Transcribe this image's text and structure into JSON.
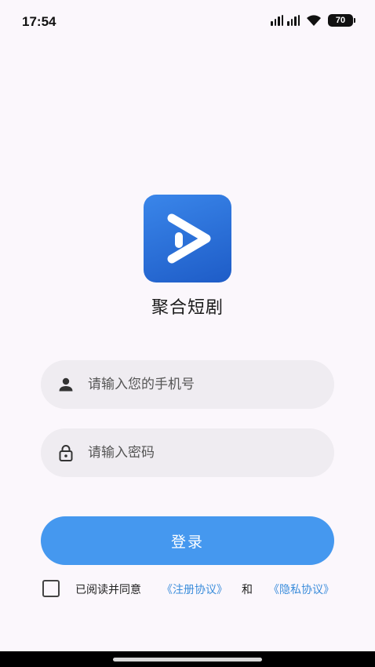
{
  "status_bar": {
    "time": "17:54",
    "battery": "70",
    "icons": [
      "signal-icon",
      "wifi-icon",
      "battery-icon"
    ]
  },
  "app": {
    "logo_icon": "play-icon",
    "name": "聚合短剧",
    "brand_color": "#2a6fdb"
  },
  "form": {
    "phone_placeholder": "请输入您的手机号",
    "phone_value": "",
    "password_placeholder": "请输入密码",
    "password_value": "",
    "login_label": "登录",
    "login_color": "#4598ef"
  },
  "agreement": {
    "checked": false,
    "prefix": "已阅读并同意",
    "register_link": "《注册协议》",
    "and": "和",
    "privacy_link": "《隐私协议》",
    "link_color": "#3b8ddb"
  }
}
